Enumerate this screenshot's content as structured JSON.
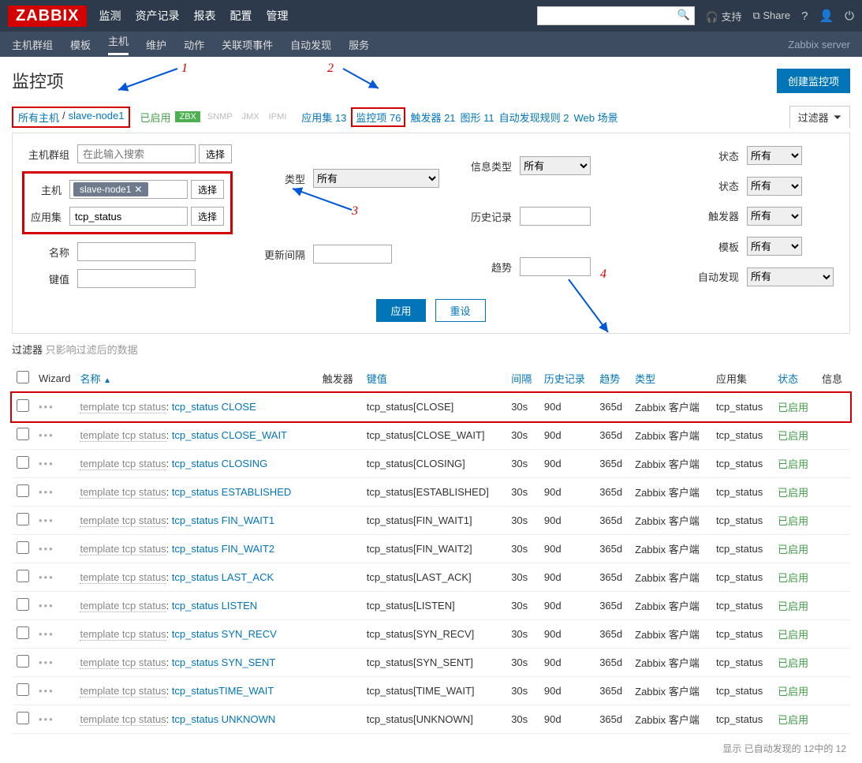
{
  "logo": "ZABBIX",
  "topnav": {
    "items": [
      "监测",
      "资产记录",
      "报表",
      "配置",
      "管理"
    ],
    "active": "配置",
    "right": {
      "support": "支持",
      "share": "Share"
    }
  },
  "subnav": {
    "items": [
      "主机群组",
      "模板",
      "主机",
      "维护",
      "动作",
      "关联项事件",
      "自动发现",
      "服务"
    ],
    "active": "主机",
    "server": "Zabbix server"
  },
  "page_title": "监控项",
  "create_btn": "创建监控项",
  "crumbs": {
    "all_hosts": "所有主机",
    "sep": "/",
    "host": "slave-node1",
    "enabled": "已启用",
    "zbx": "ZBX",
    "snmp": "SNMP",
    "jmx": "JMX",
    "ipmi": "IPMI",
    "apps": "应用集 13",
    "items": "监控项 76",
    "triggers": "触发器 21",
    "graphs": "图形 11",
    "discovery": "自动发现规则 2",
    "web": "Web 场景",
    "filter_tab": "过滤器"
  },
  "filter": {
    "hostgroup_lbl": "主机群组",
    "hostgroup_ph": "在此输入搜索",
    "select": "选择",
    "host_lbl": "主机",
    "host_val": "slave-node1",
    "app_lbl": "应用集",
    "app_val": "tcp_status",
    "name_lbl": "名称",
    "key_lbl": "键值",
    "type_lbl": "类型",
    "type_val": "所有",
    "infotype_lbl": "信息类型",
    "infotype_val": "所有",
    "interval_lbl": "更新间隔",
    "history_lbl": "历史记录",
    "trends_lbl": "趋势",
    "state_lbl": "状态",
    "state_val": "所有",
    "status_lbl": "状态",
    "status_val": "所有",
    "trigger_lbl": "触发器",
    "trigger_val": "所有",
    "tmpl_lbl": "模板",
    "tmpl_val": "所有",
    "disc_lbl": "自动发现",
    "disc_val": "所有",
    "apply": "应用",
    "reset": "重设"
  },
  "annotations": {
    "a1": "1",
    "a2": "2",
    "a3": "3",
    "a4": "4"
  },
  "filter_note": {
    "label": "过滤器",
    "muted": "只影响过滤后的数据"
  },
  "table": {
    "headers": {
      "wizard": "Wizard",
      "name": "名称",
      "triggers": "触发器",
      "key": "键值",
      "interval": "间隔",
      "history": "历史记录",
      "trends": "趋势",
      "type": "类型",
      "apps": "应用集",
      "status": "状态",
      "info": "信息"
    },
    "prefix": "template tcp status",
    "rows": [
      {
        "nm": "tcp_status CLOSE",
        "key": "tcp_status[CLOSE]",
        "int": "30s",
        "hist": "90d",
        "tr": "365d",
        "type": "Zabbix 客户端",
        "app": "tcp_status",
        "st": "已启用",
        "hl": true
      },
      {
        "nm": "tcp_status CLOSE_WAIT",
        "key": "tcp_status[CLOSE_WAIT]",
        "int": "30s",
        "hist": "90d",
        "tr": "365d",
        "type": "Zabbix 客户端",
        "app": "tcp_status",
        "st": "已启用"
      },
      {
        "nm": "tcp_status CLOSING",
        "key": "tcp_status[CLOSING]",
        "int": "30s",
        "hist": "90d",
        "tr": "365d",
        "type": "Zabbix 客户端",
        "app": "tcp_status",
        "st": "已启用"
      },
      {
        "nm": "tcp_status ESTABLISHED",
        "key": "tcp_status[ESTABLISHED]",
        "int": "30s",
        "hist": "90d",
        "tr": "365d",
        "type": "Zabbix 客户端",
        "app": "tcp_status",
        "st": "已启用"
      },
      {
        "nm": "tcp_status FIN_WAIT1",
        "key": "tcp_status[FIN_WAIT1]",
        "int": "30s",
        "hist": "90d",
        "tr": "365d",
        "type": "Zabbix 客户端",
        "app": "tcp_status",
        "st": "已启用"
      },
      {
        "nm": "tcp_status FIN_WAIT2",
        "key": "tcp_status[FIN_WAIT2]",
        "int": "30s",
        "hist": "90d",
        "tr": "365d",
        "type": "Zabbix 客户端",
        "app": "tcp_status",
        "st": "已启用"
      },
      {
        "nm": "tcp_status LAST_ACK",
        "key": "tcp_status[LAST_ACK]",
        "int": "30s",
        "hist": "90d",
        "tr": "365d",
        "type": "Zabbix 客户端",
        "app": "tcp_status",
        "st": "已启用"
      },
      {
        "nm": "tcp_status LISTEN",
        "key": "tcp_status[LISTEN]",
        "int": "30s",
        "hist": "90d",
        "tr": "365d",
        "type": "Zabbix 客户端",
        "app": "tcp_status",
        "st": "已启用"
      },
      {
        "nm": "tcp_status SYN_RECV",
        "key": "tcp_status[SYN_RECV]",
        "int": "30s",
        "hist": "90d",
        "tr": "365d",
        "type": "Zabbix 客户端",
        "app": "tcp_status",
        "st": "已启用"
      },
      {
        "nm": "tcp_status SYN_SENT",
        "key": "tcp_status[SYN_SENT]",
        "int": "30s",
        "hist": "90d",
        "tr": "365d",
        "type": "Zabbix 客户端",
        "app": "tcp_status",
        "st": "已启用"
      },
      {
        "nm": "tcp_statusTIME_WAIT",
        "key": "tcp_status[TIME_WAIT]",
        "int": "30s",
        "hist": "90d",
        "tr": "365d",
        "type": "Zabbix 客户端",
        "app": "tcp_status",
        "st": "已启用"
      },
      {
        "nm": "tcp_status UNKNOWN",
        "key": "tcp_status[UNKNOWN]",
        "int": "30s",
        "hist": "90d",
        "tr": "365d",
        "type": "Zabbix 客户端",
        "app": "tcp_status",
        "st": "已启用"
      }
    ]
  },
  "footer": "显示 已自动发现的 12中的 12"
}
